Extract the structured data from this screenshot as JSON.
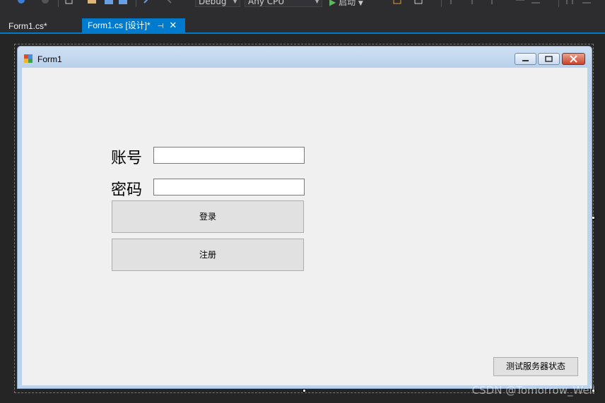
{
  "toolbar": {
    "config": "Debug",
    "platform": "Any CPU",
    "start_label": "启动"
  },
  "tabs": [
    {
      "label": "Form1.cs*"
    },
    {
      "label": "Form1.cs [设计]*",
      "pin": "⊣",
      "close": "✕"
    }
  ],
  "form": {
    "title": "Form1",
    "account_label": "账号",
    "password_label": "密码",
    "account_value": "",
    "password_value": "",
    "login_button": "登录",
    "register_button": "注册",
    "test_button": "测试服务器状态"
  },
  "watermark": "CSDN @Tomorrow_Well",
  "colors": {
    "accent": "#007acc",
    "form_bg": "#f0f0f0",
    "ide_bg": "#252526"
  }
}
